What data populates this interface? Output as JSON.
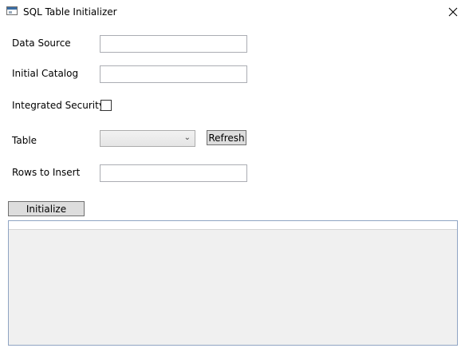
{
  "window": {
    "title": "SQL Table Initializer",
    "icon": "app-window-icon",
    "close_glyph": "✕"
  },
  "form": {
    "data_source": {
      "label": "Data Source",
      "value": ""
    },
    "initial_catalog": {
      "label": "Initial Catalog",
      "value": ""
    },
    "integrated_security": {
      "label": "Integrated Security",
      "checked": false
    },
    "table": {
      "label": "Table",
      "selected": "",
      "chevron": "⌄"
    },
    "refresh_label": "Refresh",
    "rows_to_insert": {
      "label": "Rows to Insert",
      "value": ""
    },
    "initialize_label": "Initialize"
  },
  "results_grid": {
    "rows": []
  }
}
